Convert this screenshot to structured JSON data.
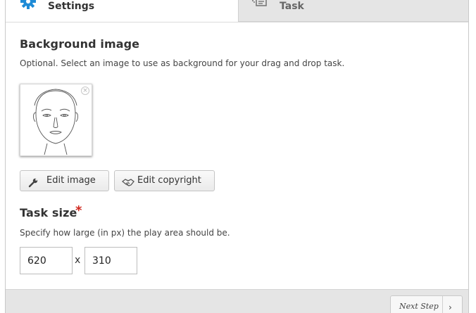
{
  "tabs": {
    "settings": {
      "label": "Settings",
      "icon": "gear-icon"
    },
    "task": {
      "label": "Task",
      "icon": "task-icon"
    }
  },
  "background": {
    "title": "Background image",
    "description": "Optional. Select an image to use as background for your drag and drop task.",
    "image": "face-outline-sketch",
    "remove_symbol": "×"
  },
  "buttons": {
    "edit_image": "Edit image",
    "edit_copyright": "Edit copyright"
  },
  "task_size": {
    "title": "Task size",
    "required_mark": "*",
    "description": "Specify how large (in px) the play area should be.",
    "width": "620",
    "separator": "x",
    "height": "310"
  },
  "footer": {
    "next_step": "Next Step",
    "next_arrow": "›"
  },
  "colors": {
    "accent": "#1f8bd6",
    "required": "#d0281f",
    "inactive_tab": "#e5e5e5"
  }
}
